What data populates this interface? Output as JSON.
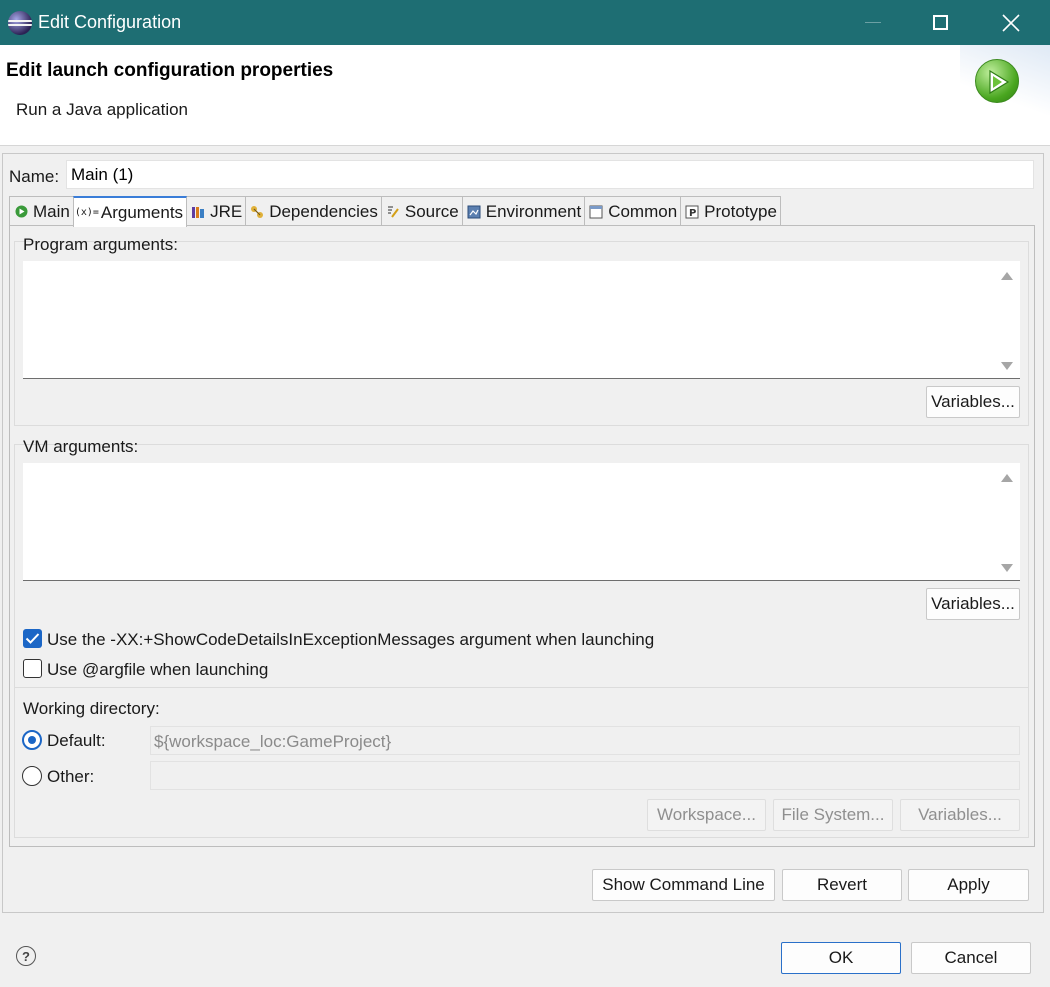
{
  "window": {
    "title": "Edit Configuration"
  },
  "header": {
    "title": "Edit launch configuration properties",
    "subtitle": "Run a Java application"
  },
  "name_field": {
    "label": "Name:",
    "value": "Main (1)"
  },
  "tabs": [
    {
      "label": "Main",
      "icon": "main-tab-icon",
      "active": false
    },
    {
      "label": "Arguments",
      "icon": "arguments-tab-icon",
      "active": true
    },
    {
      "label": "JRE",
      "icon": "jre-tab-icon",
      "active": false
    },
    {
      "label": "Dependencies",
      "icon": "dependencies-tab-icon",
      "active": false
    },
    {
      "label": "Source",
      "icon": "source-tab-icon",
      "active": false
    },
    {
      "label": "Environment",
      "icon": "environment-tab-icon",
      "active": false
    },
    {
      "label": "Common",
      "icon": "common-tab-icon",
      "active": false
    },
    {
      "label": "Prototype",
      "icon": "prototype-tab-icon",
      "active": false
    }
  ],
  "program_arguments": {
    "label": "Program arguments:",
    "value": "",
    "variables_button": "Variables..."
  },
  "vm_arguments": {
    "label": "VM arguments:",
    "value": "",
    "variables_button": "Variables..."
  },
  "options": {
    "show_code_details": {
      "label": "Use the -XX:+ShowCodeDetailsInExceptionMessages argument when launching",
      "checked": true
    },
    "argfile": {
      "label": "Use @argfile when launching",
      "checked": false
    }
  },
  "working_directory": {
    "label": "Working directory:",
    "default_label": "Default:",
    "default_value": "${workspace_loc:GameProject}",
    "default_selected": true,
    "other_label": "Other:",
    "other_value": "",
    "workspace_button": "Workspace...",
    "file_system_button": "File System...",
    "variables_button": "Variables..."
  },
  "actions": {
    "show_command_line": "Show Command Line",
    "revert": "Revert",
    "apply": "Apply",
    "ok": "OK",
    "cancel": "Cancel"
  },
  "colors": {
    "titlebar": "#1e6e73",
    "accent": "#1b66c6"
  }
}
